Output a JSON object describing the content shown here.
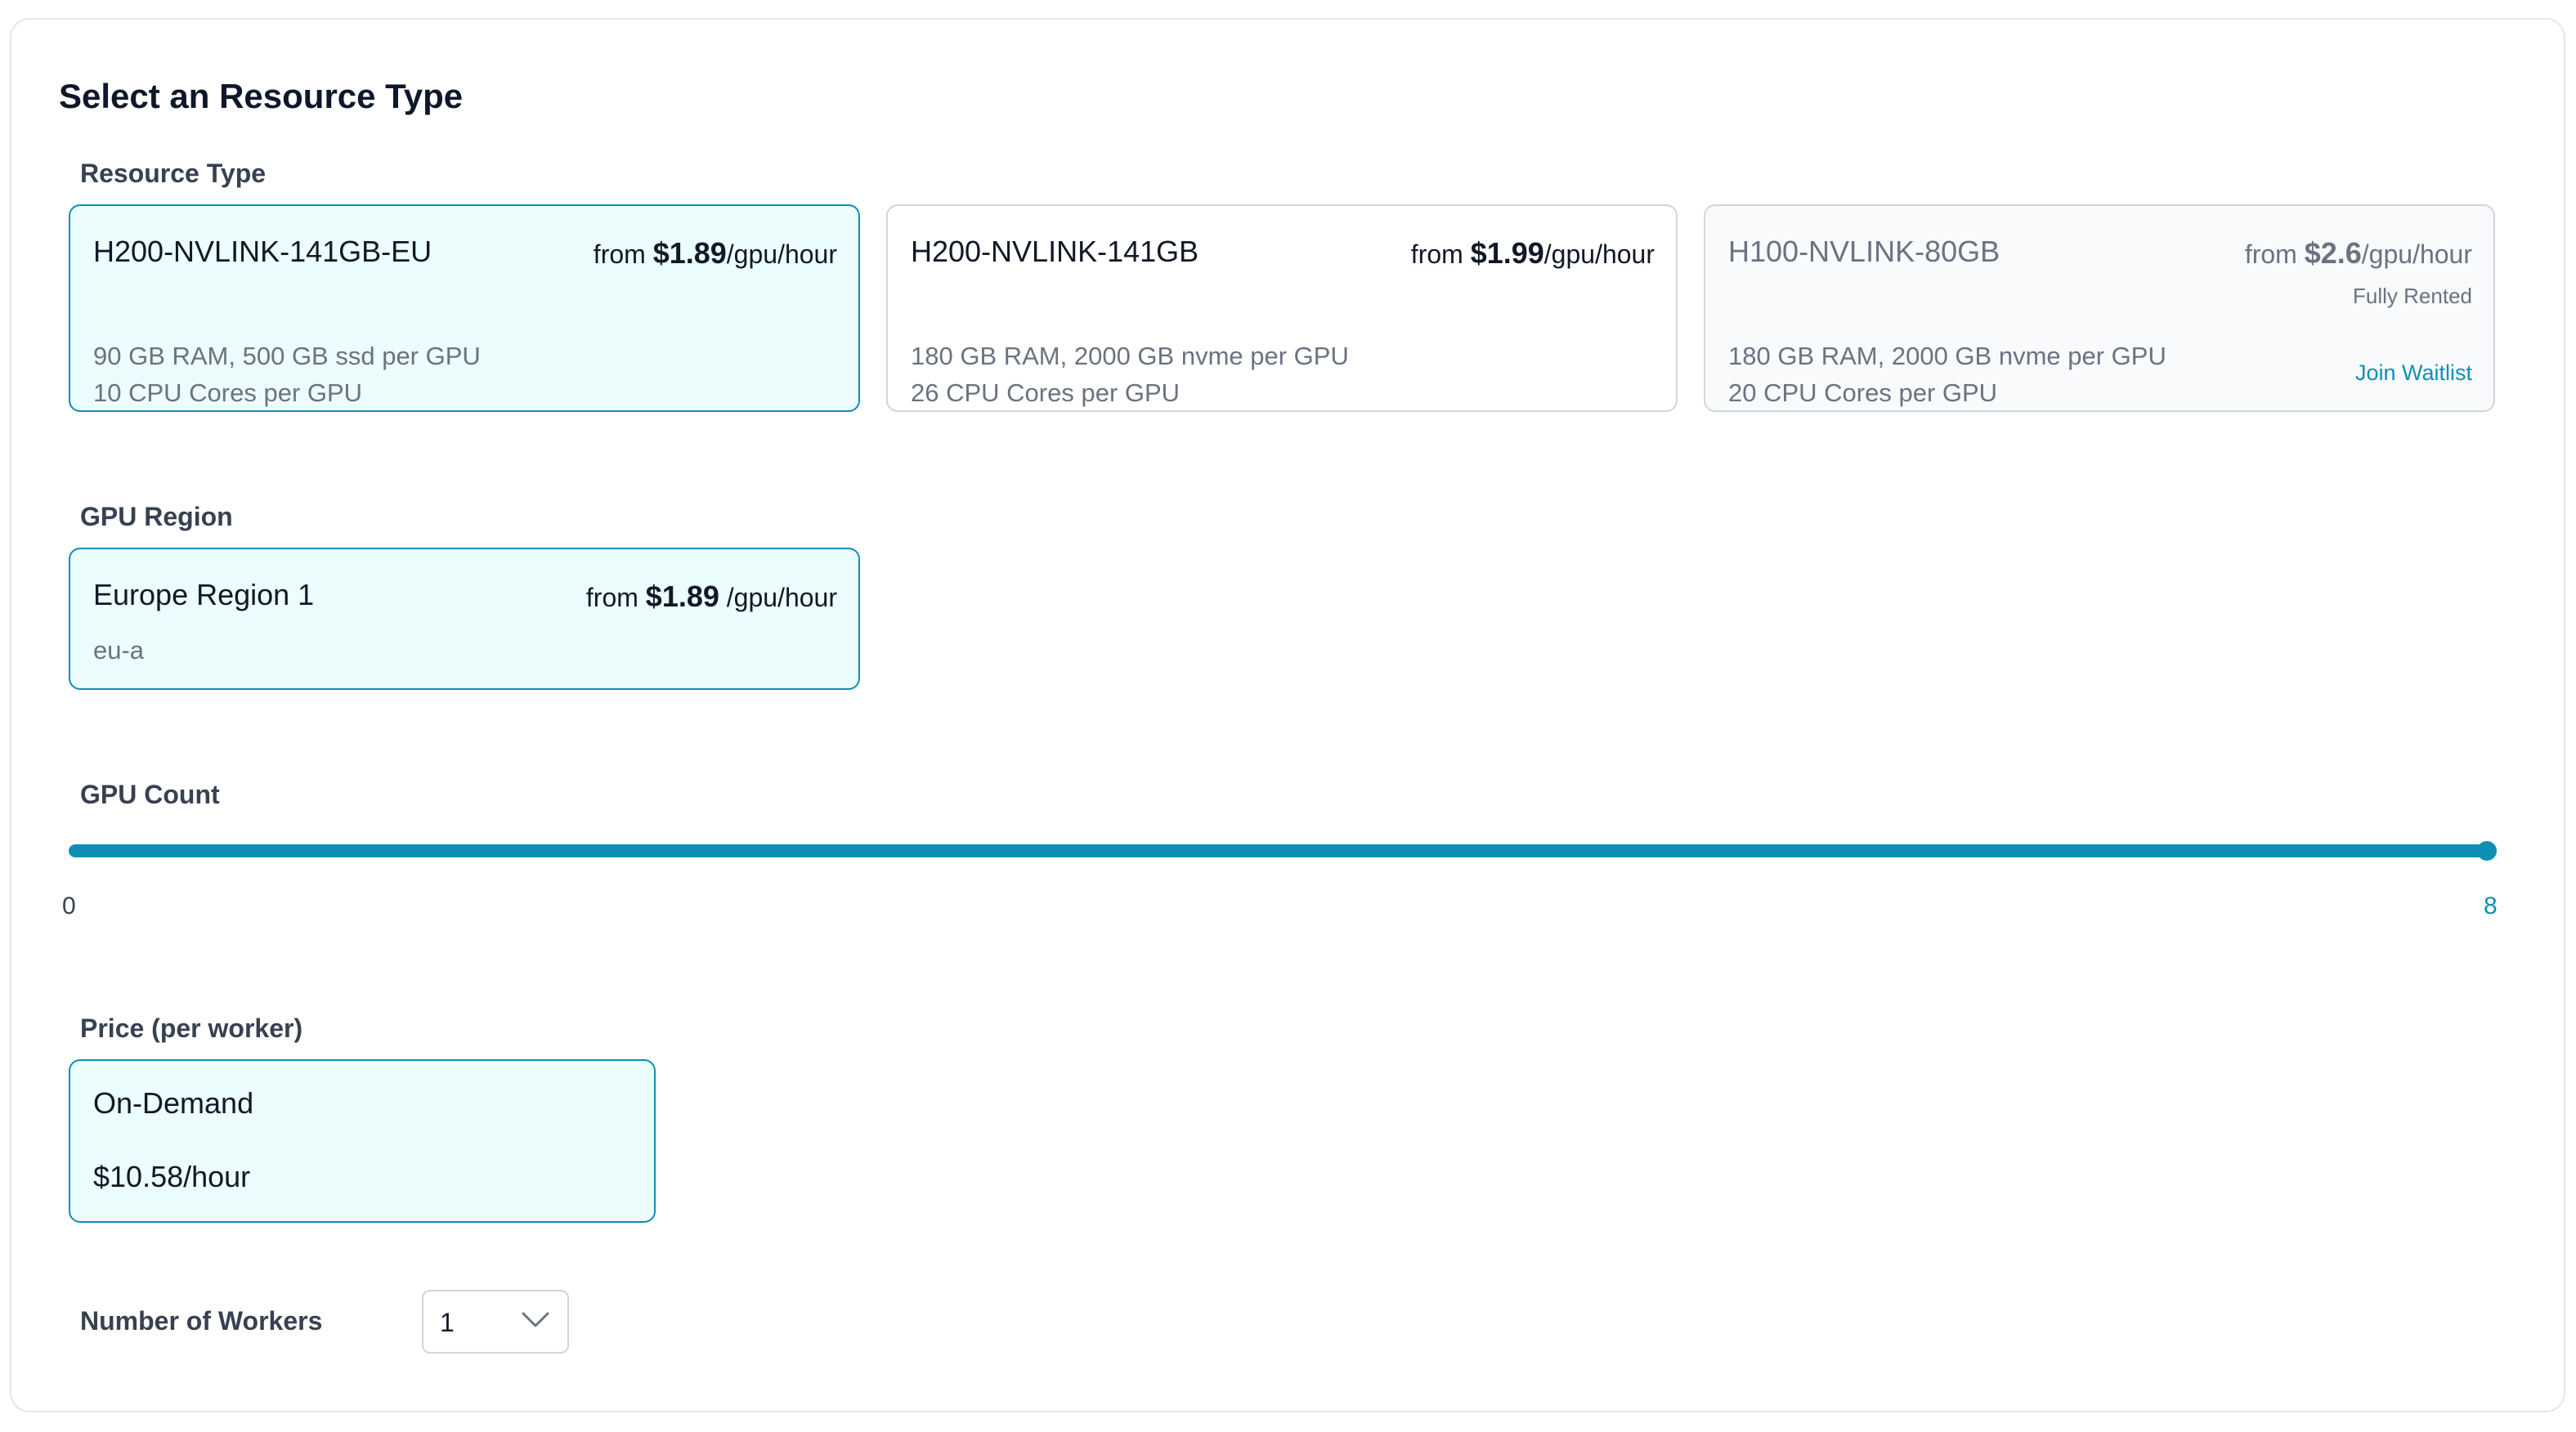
{
  "heading": "Select an Resource Type",
  "resource_type": {
    "label": "Resource Type",
    "cards": [
      {
        "name": "H200-NVLINK-141GB-EU",
        "price_prefix": "from ",
        "price": "$1.89",
        "price_unit": "/gpu/hour",
        "spec1": "90 GB RAM, 500 GB ssd per GPU",
        "spec2": "10 CPU Cores per GPU",
        "selected": true
      },
      {
        "name": "H200-NVLINK-141GB",
        "price_prefix": "from ",
        "price": "$1.99",
        "price_unit": "/gpu/hour",
        "spec1": "180 GB RAM, 2000 GB nvme per GPU",
        "spec2": "26 CPU Cores per GPU",
        "selected": false
      },
      {
        "name": "H100-NVLINK-80GB",
        "price_prefix": "from ",
        "price": "$2.6",
        "price_unit": "/gpu/hour",
        "status": "Fully Rented",
        "spec1": "180 GB RAM, 2000 GB nvme per GPU",
        "spec2": "20 CPU Cores per GPU",
        "action": "Join Waitlist",
        "selected": false,
        "disabled": true
      }
    ]
  },
  "gpu_region": {
    "label": "GPU Region",
    "card": {
      "name": "Europe Region 1",
      "price_prefix": "from ",
      "price": "$1.89",
      "price_unit": " /gpu/hour",
      "code": "eu-a",
      "selected": true
    }
  },
  "gpu_count": {
    "label": "GPU Count",
    "min": "0",
    "max": "8",
    "value": 8
  },
  "price": {
    "label": "Price (per worker)",
    "card": {
      "type": "On-Demand",
      "amount": "$10.58/hour"
    }
  },
  "workers": {
    "label": "Number of Workers",
    "selected": "1"
  },
  "colors": {
    "accent": "#0e8fb3",
    "selected_bg": "#ecfdfe",
    "border": "#d1d5db"
  }
}
